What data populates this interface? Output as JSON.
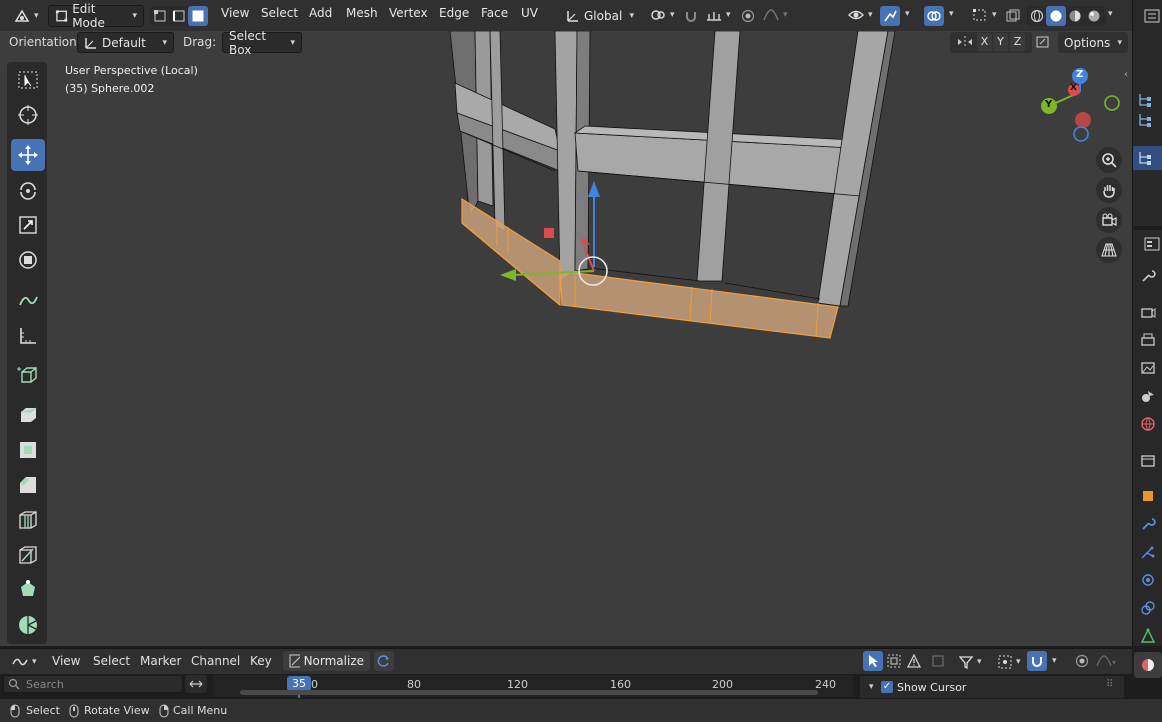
{
  "header": {
    "mode": "Edit Mode",
    "menus": [
      "View",
      "Select",
      "Add",
      "Mesh",
      "Vertex",
      "Edge",
      "Face",
      "UV"
    ],
    "transform_orientation": "Global"
  },
  "tool_settings": {
    "orientation_label": "Orientation:",
    "orientation_value": "Default",
    "drag_label": "Drag:",
    "drag_value": "Select Box",
    "axes": [
      "X",
      "Y",
      "Z"
    ],
    "options_label": "Options"
  },
  "viewport": {
    "view_name": "User Perspective (Local)",
    "object_info": "(35) Sphere.002",
    "gizmo_axes": {
      "x": "X",
      "y": "Y",
      "z": "Z"
    },
    "colors": {
      "selection": "#f39c3c",
      "x_axis": "#e04a4a",
      "y_axis": "#7ab829",
      "z_axis": "#3f86e0",
      "bg": "#3d3d3d"
    }
  },
  "toolbar": {
    "tools": [
      "select-box",
      "cursor",
      "move",
      "rotate",
      "scale",
      "transform",
      "annotate",
      "measure",
      "add-cube",
      "extrude-region",
      "inset-faces",
      "bevel",
      "loop-cut",
      "knife",
      "poly-build",
      "spin"
    ],
    "active_tool": "move"
  },
  "timeline": {
    "menus": [
      "View",
      "Select",
      "Marker",
      "Channel",
      "Key"
    ],
    "normalize_label": "Normalize",
    "search_placeholder": "Search",
    "current_frame": "35",
    "frame_ticks": [
      "0",
      "80",
      "120",
      "160",
      "200",
      "240"
    ],
    "show_cursor_label": "Show Cursor"
  },
  "statusbar": {
    "items": [
      "Select",
      "Rotate View",
      "Call Menu"
    ]
  }
}
